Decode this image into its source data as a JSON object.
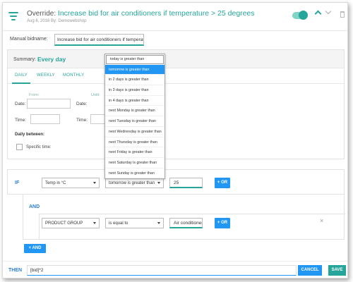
{
  "header": {
    "title_prefix": "Override:",
    "title": "Increase bid for air conditioners if temperature > 25 degrees",
    "date": "Aug 6, 2016",
    "by_label": "By:",
    "author": "Demowebshop",
    "toggle_on": true,
    "accent_color": "#26a69a"
  },
  "bidname": {
    "label": "Manual bidname:",
    "value": "Increase bid for air conditioners if temperatu"
  },
  "schedule": {
    "summary_label": "Summary:",
    "summary_value": "Every day",
    "tabs": [
      {
        "label": "DAILY",
        "active": true
      },
      {
        "label": "WEEKLY",
        "active": false
      },
      {
        "label": "MONTHLY",
        "active": false
      }
    ],
    "from_label": "From:",
    "until_label": "Until:",
    "date_label": "Date:",
    "time_label": "Time:",
    "daily_between": "Daily between:",
    "specific_time": "Specific time:"
  },
  "dropdown": {
    "items": [
      "today is greater than",
      "tomorrow is greater than",
      "in 2 days is greater than",
      "in 3 days is greater than",
      "in 4 days is greater than",
      "next Monday is greater than",
      "next Tuesday is greater than",
      "next Wednesday is greater than",
      "next Thursday is greater than",
      "next Friday is greater than",
      "next Saturday is greater than",
      "next Sunday is greater than"
    ],
    "selected_index": 1
  },
  "conditions": {
    "if_label": "IF",
    "if_field": "Temp in °C",
    "if_operator": "tomorrow is greater than",
    "if_value": "25",
    "or_label": "+ OR",
    "and_label": "AND",
    "and_field": "PRODUCT GROUP",
    "and_operator": "is equal to",
    "and_value": "Air conditioner",
    "close_icon": "×",
    "add_and_label": "+ AND"
  },
  "then": {
    "label": "THEN",
    "value": "[bid]*2",
    "cancel_label": "CANCEL",
    "save_label": "SAVE"
  }
}
